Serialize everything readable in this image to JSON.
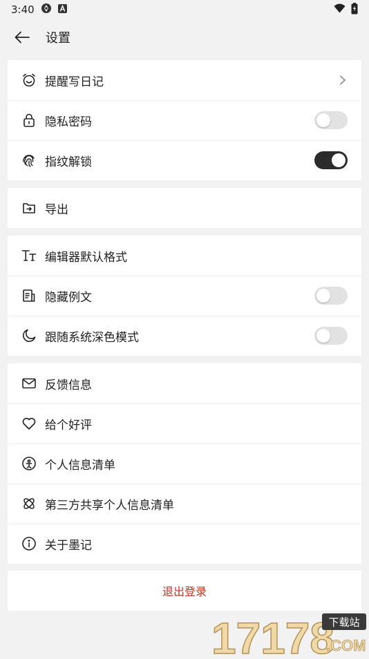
{
  "status_bar": {
    "time": "3:40"
  },
  "header": {
    "title": "设置"
  },
  "groups": [
    {
      "items": [
        {
          "label": "提醒写日记",
          "icon": "alarm-clock-icon",
          "control": "chevron"
        },
        {
          "label": "隐私密码",
          "icon": "lock-icon",
          "control": "toggle",
          "on": false
        },
        {
          "label": "指纹解锁",
          "icon": "fingerprint-icon",
          "control": "toggle",
          "on": true
        }
      ]
    },
    {
      "items": [
        {
          "label": "导出",
          "icon": "export-icon",
          "control": "none"
        }
      ]
    },
    {
      "items": [
        {
          "label": "编辑器默认格式",
          "icon": "text-format-icon",
          "control": "none"
        },
        {
          "label": "隐藏例文",
          "icon": "document-icon",
          "control": "toggle",
          "on": false
        },
        {
          "label": "跟随系统深色模式",
          "icon": "moon-icon",
          "control": "toggle",
          "on": false
        }
      ]
    },
    {
      "items": [
        {
          "label": "反馈信息",
          "icon": "mail-icon",
          "control": "none"
        },
        {
          "label": "给个好评",
          "icon": "heart-icon",
          "control": "none"
        },
        {
          "label": "个人信息清单",
          "icon": "person-info-icon",
          "control": "none"
        },
        {
          "label": "第三方共享个人信息清单",
          "icon": "share-atom-icon",
          "control": "none"
        },
        {
          "label": "关于墨记",
          "icon": "info-icon",
          "control": "none"
        }
      ]
    }
  ],
  "logout_label": "退出登录",
  "watermark": {
    "number": "17178",
    "badge": "下载站",
    "suffix": ".COM"
  },
  "colors": {
    "accent_danger": "#c62f1f",
    "toggle_on": "#2b2b2b",
    "toggle_off": "#e2e2e2"
  }
}
